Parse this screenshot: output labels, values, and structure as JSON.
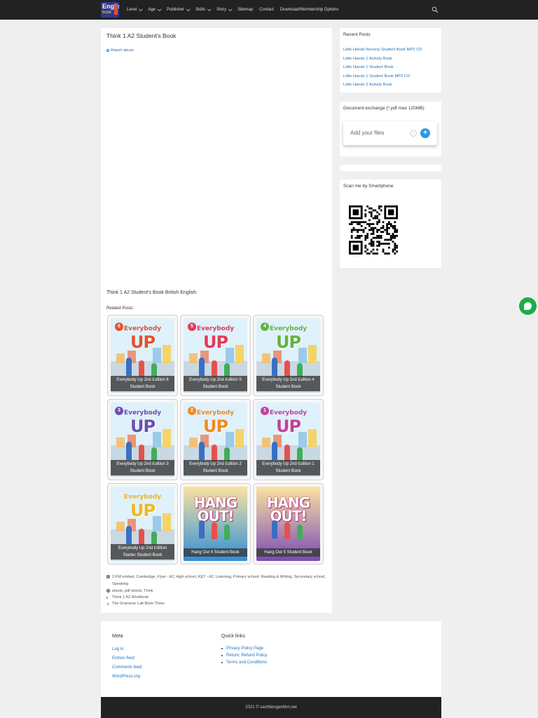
{
  "header": {
    "logo_line1": "English",
    "logo_line2": "book",
    "nav": [
      {
        "label": "Level",
        "has_dropdown": true
      },
      {
        "label": "Age",
        "has_dropdown": true
      },
      {
        "label": "Publisher",
        "has_dropdown": true
      },
      {
        "label": "Skills",
        "has_dropdown": true
      },
      {
        "label": "Story",
        "has_dropdown": true
      },
      {
        "label": "Sitemap",
        "has_dropdown": false
      },
      {
        "label": "Contact",
        "has_dropdown": false
      },
      {
        "label": "Download/Membership Options",
        "has_dropdown": false
      }
    ],
    "search_icon": "search-icon"
  },
  "article": {
    "title": "Think 1 A2 Student's Book",
    "report_abuse": "Report abuse",
    "subtitle": "Think 1 A2 Student's Book British English",
    "related_label": "Related Posts:",
    "related": [
      {
        "caption": "Everybody Up 2nd Edition 6 Student Book",
        "number": "6",
        "color": "#e0532d"
      },
      {
        "caption": "Everybody Up 2nd Edition 5 Student Book",
        "number": "5",
        "color": "#e23a58"
      },
      {
        "caption": "Everybody Up 2nd Edition 4 Student Book",
        "number": "4",
        "color": "#5fb53d"
      },
      {
        "caption": "Everybody Up 2nd Edition 3 Student Book",
        "number": "3",
        "color": "#6c4fb0"
      },
      {
        "caption": "Everybody Up 2nd Edition 2 Student Book",
        "number": "2",
        "color": "#ef8a25"
      },
      {
        "caption": "Everybody Up 2nd Edition 1 Student Book",
        "number": "1",
        "color": "#c2439a"
      },
      {
        "caption": "Everybody Up 2nd Edition Starter Student Book",
        "number": "",
        "color": "#f0b81c"
      },
      {
        "caption": "Hang Out 4 Student Book",
        "number": "4",
        "color": "#2f8fd8"
      },
      {
        "caption": "Hang Out 5 Student Book",
        "number": "5",
        "color": "#7b4ab8"
      }
    ],
    "cover_brand": "Everybody",
    "cover_big": "UP",
    "cover_hang": "HANG OUT!",
    "categories": "2-Pdf embed, Cambridge, Flyer - A2, High school, KET - A2, Listening, Primary school, Reading & Writing, Secondary school, Speaking",
    "tags": "ebook, pdf ebook, Think",
    "prev_post": "Think 1 A2 Workbook",
    "next_post": "The Grammar Lab Book Three"
  },
  "sidebar": {
    "recent_title": "Recent Posts",
    "recent_posts": [
      "Little Hands Nursery Student Book MP3 CD",
      "Little Hands 1 Activity Book",
      "Little Hands 1 Student Book",
      "Little Hands 1 Student Book MP3 CD",
      "Little Hands 2 Activity Book"
    ],
    "exchange_title": "Document exchange (*.pdf max 120MB)",
    "upload_label": "Add your files",
    "upload_plus": "+",
    "scan_title": "Scan me by Smartphone"
  },
  "footer": {
    "meta_title": "Meta",
    "meta_links": [
      "Log in",
      "Entries feed",
      "Comments feed",
      "WordPress.org"
    ],
    "quick_title": "Quick links",
    "quick_links": [
      "Privacy Policy Page",
      "Return; Refund Policy",
      "Terms and Conditions"
    ],
    "copyright": "2021 © sachtienganhhn.net"
  },
  "colors": {
    "header_bg": "#222222",
    "link": "#1e73be",
    "chat": "#1aae4a",
    "upload_button": "#2d9be0"
  }
}
